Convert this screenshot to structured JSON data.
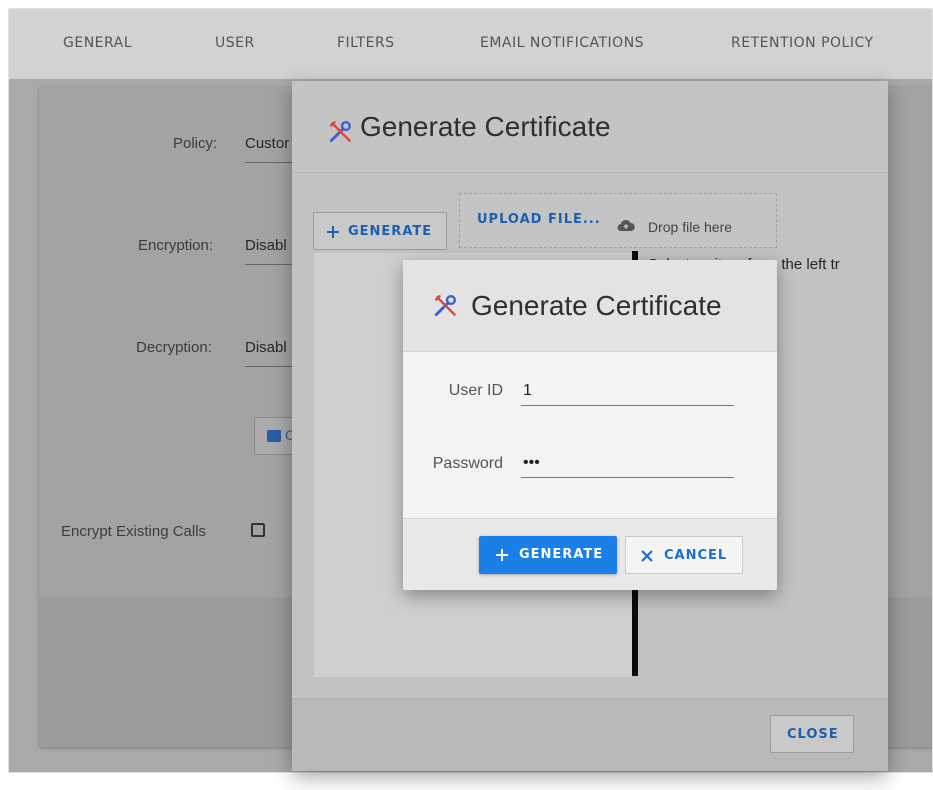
{
  "tabs": [
    "GENERAL",
    "USER",
    "FILTERS",
    "EMAIL NOTIFICATIONS",
    "RETENTION POLICY"
  ],
  "settings": {
    "policy_label": "Policy:",
    "policy_value": "Custor",
    "encryption_label": "Encryption:",
    "encryption_value": "Disabl",
    "decryption_label": "Decryption:",
    "decryption_value": "Disabl",
    "partial_button_label": "C",
    "encrypt_existing_label": "Encrypt Existing Calls"
  },
  "outer_dialog": {
    "title": "Generate Certificate",
    "generate_label": "GENERATE",
    "upload_label": "UPLOAD FILE...",
    "drop_hint": "Drop file here",
    "hint_text": "Select an item from the left tr",
    "close_label": "CLOSE"
  },
  "inner_dialog": {
    "title": "Generate Certificate",
    "user_id_label": "User ID",
    "user_id_value": "1",
    "password_label": "Password",
    "password_value": "•••",
    "generate_label": "GENERATE",
    "cancel_label": "CANCEL"
  },
  "colors": {
    "accent": "#1a7fe6",
    "link_blue": "#1c5fb0",
    "tools_icon": "#3b5fd0"
  }
}
